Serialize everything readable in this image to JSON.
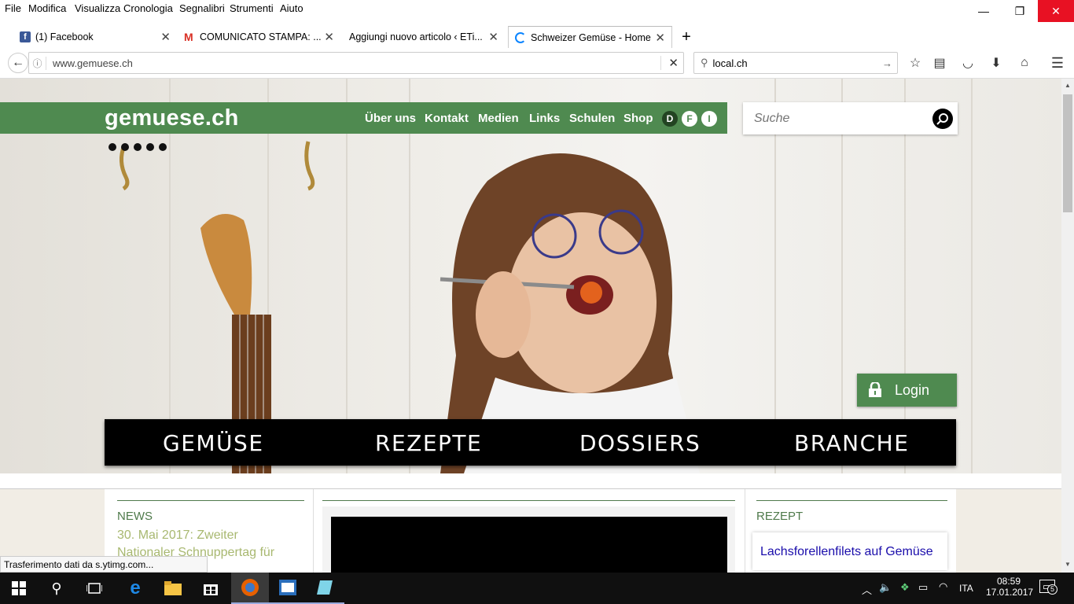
{
  "menubar": {
    "items": [
      "File",
      "Modifica",
      "Visualizza",
      "Cronologia",
      "Segnalibri",
      "Strumenti",
      "Aiuto"
    ]
  },
  "window_controls": {
    "minimize": "—",
    "restore": "❐",
    "close": "✕"
  },
  "tabs": [
    {
      "label": "(1) Facebook",
      "icon": "facebook-icon",
      "active": false
    },
    {
      "label": "COMUNICATO STAMPA: ...",
      "icon": "gmail-icon",
      "active": false
    },
    {
      "label": "Aggiungi nuovo articolo ‹ ETi...",
      "icon": "none",
      "active": false
    },
    {
      "label": "Schweizer Gemüse - Home",
      "icon": "loading-icon",
      "active": true
    }
  ],
  "navbar": {
    "url": "www.gemuese.ch",
    "search_value": "local.ch"
  },
  "site": {
    "logo": "gemuese.ch",
    "top_links": [
      "Über uns",
      "Kontakt",
      "Medien",
      "Links",
      "Schulen",
      "Shop"
    ],
    "languages": [
      "D",
      "F",
      "I"
    ],
    "search_placeholder": "Suche",
    "login_label": "Login",
    "categories": [
      "GEMÜSE",
      "REZEPTE",
      "DOSSIERS",
      "BRANCHE"
    ],
    "news": {
      "heading": "NEWS",
      "text_line1": "30. Mai 2017: Zweiter",
      "text_line2": "Nationaler Schnuppertag für"
    },
    "recipe": {
      "heading": "REZEPT",
      "title": "Lachsforellenfilets auf Gemüse"
    }
  },
  "status_text": "Trasferimento dati da s.ytimg.com...",
  "tray": {
    "language": "ITA",
    "time": "08:59",
    "date": "17.01.2017",
    "notifications": "5"
  },
  "colors": {
    "brand_green": "#4f8a50",
    "link_blue": "#1a0dab",
    "news_text": "#a8b870",
    "close_red": "#e81123"
  }
}
